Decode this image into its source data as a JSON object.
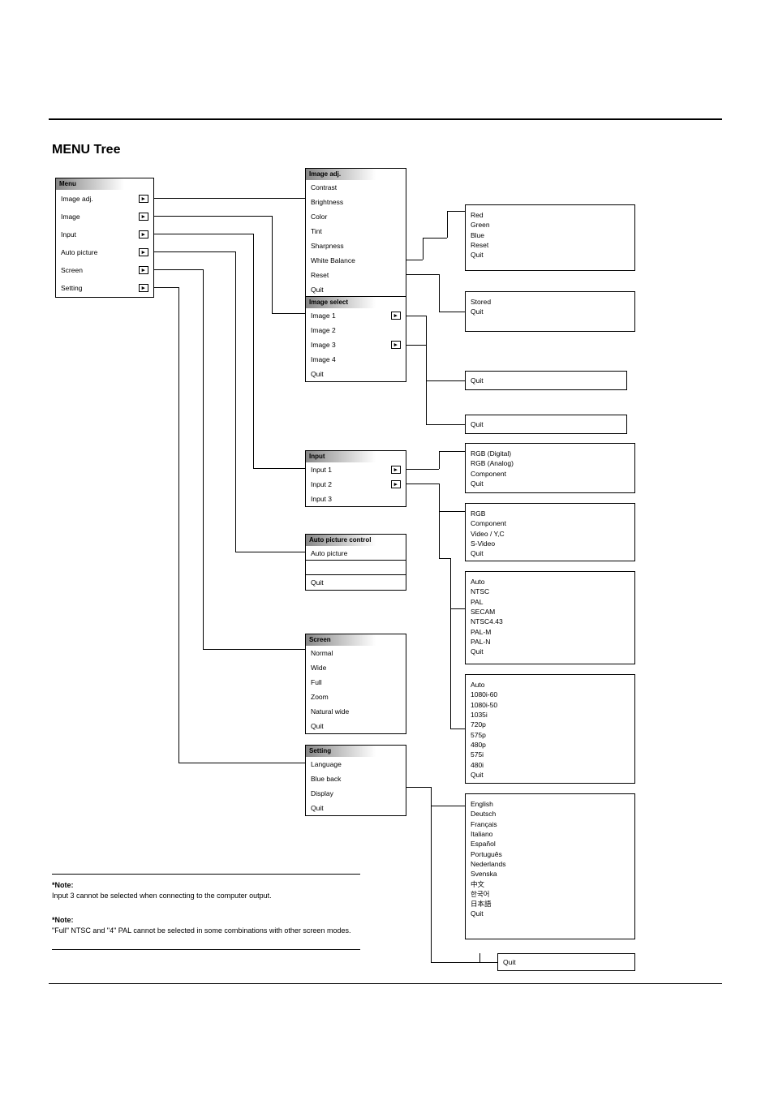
{
  "title": "MENU Tree",
  "root": {
    "header": "Menu",
    "items": [
      "Image adj.",
      "Image",
      "Input",
      "Auto picture",
      "Screen",
      "Setting"
    ]
  },
  "imageAdj": {
    "header": "Image adj.",
    "items": [
      "Contrast",
      "Brightness",
      "Color",
      "Tint",
      "Sharpness",
      "White Balance",
      "Reset",
      "Quit"
    ]
  },
  "image": {
    "header": "Image select",
    "items": [
      "Image 1",
      "Image 2",
      "Image 3",
      "Image 4",
      "Quit"
    ]
  },
  "input": {
    "header": "Input",
    "items": [
      "Input 1",
      "Input 2",
      "Input 3"
    ]
  },
  "autoPic": {
    "header": "Auto picture control",
    "items": [
      "Auto picture",
      "Quit"
    ]
  },
  "screen": {
    "header": "Screen",
    "items": [
      "Normal",
      "Wide",
      "Full",
      "Zoom",
      "Natural wide",
      "Quit"
    ]
  },
  "setting": {
    "header": "Setting",
    "items": [
      "Language",
      "Blue back",
      "Display",
      "Quit"
    ]
  },
  "whiteBalance": {
    "items": [
      "Red",
      "Green",
      "Blue",
      "Reset",
      "Quit"
    ]
  },
  "store": {
    "items": [
      "Stored",
      "Quit"
    ]
  },
  "h": {
    "q1": "Quit",
    "q2": "Quit"
  },
  "inputOpt1": {
    "items": [
      "RGB (Digital)",
      "RGB (Analog)",
      "Component",
      "Quit"
    ]
  },
  "inputOpt2": {
    "items": [
      "RGB",
      "Component",
      "Video / Y,C",
      "S-Video",
      "Quit"
    ]
  },
  "ntsc": {
    "items": [
      "Auto",
      "NTSC",
      "PAL",
      "SECAM",
      "NTSC4.43",
      "PAL-M",
      "PAL-N",
      "Quit"
    ]
  },
  "comp": {
    "items": [
      "Auto",
      "1080i-60",
      "1080i-50",
      "1035i",
      "720p",
      "575p",
      "480p",
      "575i",
      "480i",
      "Quit"
    ]
  },
  "lang": {
    "items": [
      "English",
      "Deutsch",
      "Français",
      "Italiano",
      "Español",
      "Português",
      "Nederlands",
      "Svenska",
      "中文",
      "한국어",
      "日本語",
      "Quit"
    ]
  },
  "q": {
    "q": "Quit"
  },
  "note1": {
    "hdr": "*Note:",
    "body": "Input 3 cannot be selected when connecting to the computer output."
  },
  "note2": {
    "hdr": "*Note:",
    "body": "\"Full\" NTSC and \"4\" PAL cannot be selected in some combinations with other screen modes."
  }
}
